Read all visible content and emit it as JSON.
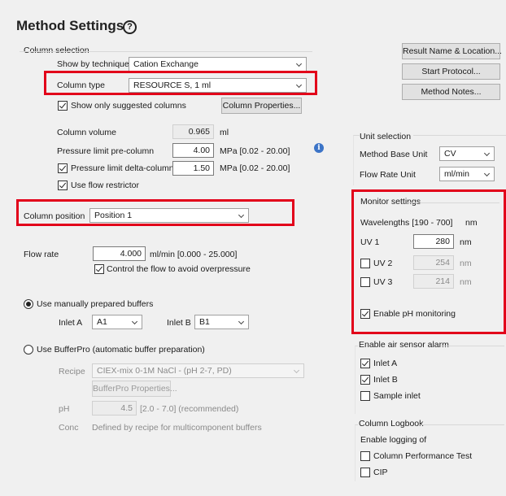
{
  "header": {
    "title": "Method Settings",
    "help_icon": "?"
  },
  "column_selection": {
    "heading": "Column selection",
    "show_by_technique_label": "Show by technique",
    "technique": "Cation Exchange",
    "column_type_label": "Column type",
    "column_type": "RESOURCE S, 1 ml",
    "only_suggested_label": "Show only suggested columns",
    "only_suggested_checked": true,
    "properties_button": "Column Properties..."
  },
  "column_params": {
    "volume_label": "Column volume",
    "volume_value": "0.965",
    "volume_unit": "ml",
    "pre_label": "Pressure limit pre-column",
    "pre_value": "4.00",
    "pre_unit": "MPa [0.02 - 20.00]",
    "delta_label": "Pressure limit delta-column",
    "delta_checked": true,
    "delta_value": "1.50",
    "delta_unit": "MPa [0.02 - 20.00]",
    "restrictor_label": "Use flow restrictor",
    "restrictor_checked": true
  },
  "column_position": {
    "label": "Column position",
    "value": "Position 1"
  },
  "flow": {
    "label": "Flow rate",
    "value": "4.000",
    "unit": "ml/min   [0.000 - 25.000]",
    "control_label": "Control the flow to avoid overpressure",
    "control_checked": true
  },
  "buffers": {
    "manual_label": "Use manually prepared buffers",
    "manual_selected": true,
    "inlet_a_label": "Inlet A",
    "inlet_a": "A1",
    "inlet_b_label": "Inlet B",
    "inlet_b": "B1",
    "bufferpro_label": "Use BufferPro (automatic buffer preparation)",
    "recipe_label": "Recipe",
    "recipe": "CIEX-mix 0-1M NaCl - (pH 2-7, PD)",
    "bufferpro_button": "BufferPro Properties...",
    "ph_label": "pH",
    "ph_value": "4.5",
    "ph_range": "[2.0 - 7.0]   (recommended)",
    "conc_label": "Conc",
    "conc_text": "Defined by recipe for multicomponent buffers"
  },
  "right_buttons": {
    "result_name": "Result Name & Location...",
    "start_protocol": "Start Protocol...",
    "method_notes": "Method Notes..."
  },
  "unit_selection": {
    "heading": "Unit selection",
    "base_label": "Method Base Unit",
    "base_value": "CV",
    "flow_label": "Flow Rate Unit",
    "flow_value": "ml/min"
  },
  "monitor": {
    "heading": "Monitor settings",
    "wavelengths_label": "Wavelengths   [190 - 700]",
    "wavelengths_unit": "nm",
    "uv1_label": "UV 1",
    "uv1_value": "280",
    "uv2_label": "UV 2",
    "uv2_checked": false,
    "uv2_value": "254",
    "uv3_label": "UV 3",
    "uv3_checked": false,
    "uv3_value": "214",
    "nm": "nm",
    "ph_label": "Enable pH monitoring",
    "ph_checked": true
  },
  "air_sensor": {
    "heading": "Enable air sensor alarm",
    "inlet_a_label": "Inlet A",
    "inlet_a_checked": true,
    "inlet_b_label": "Inlet B",
    "inlet_b_checked": true,
    "sample_label": "Sample inlet",
    "sample_checked": false
  },
  "logbook": {
    "heading": "Column Logbook",
    "enable_label": "Enable logging of",
    "cpt_label": "Column Performance Test",
    "cpt_checked": false,
    "cip_label": "CIP",
    "cip_checked": false
  },
  "colors": {
    "highlight": "#e2001a",
    "info_icon": "#3c74c7"
  }
}
